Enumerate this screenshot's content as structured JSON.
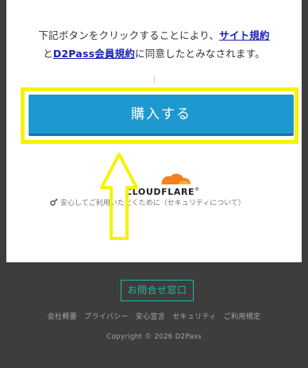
{
  "terms": {
    "prefix": "下記ボタンをクリックすることにより、",
    "link1": "サイト規約",
    "middle": "と",
    "link2": "D2Pass会員規約",
    "suffix": "に同意したとみなされます。"
  },
  "purchase": {
    "label": "購入する"
  },
  "cloudflare": {
    "logo_text": "CLOUDFLARE",
    "registered": "®",
    "note": "安心してご利用いただくために（セキュリティについて）",
    "logo_color": "#f48120"
  },
  "annotation": {
    "highlight_color": "#f4f400",
    "arrow_color": "#f4f400",
    "arrow_direction": "up"
  },
  "footer": {
    "contact_label": "お問合せ窓口",
    "links": [
      "会社概要",
      "プライバシー",
      "安心宣言",
      "セキュリティ",
      "ご利用規定"
    ],
    "copyright": "Copyright © 2026 D2Pass"
  },
  "colors": {
    "button_blue": "#1f98cf",
    "link_blue": "#1a22b8",
    "contact_teal": "#27b6a6",
    "footer_bg": "#3d3d3d"
  }
}
